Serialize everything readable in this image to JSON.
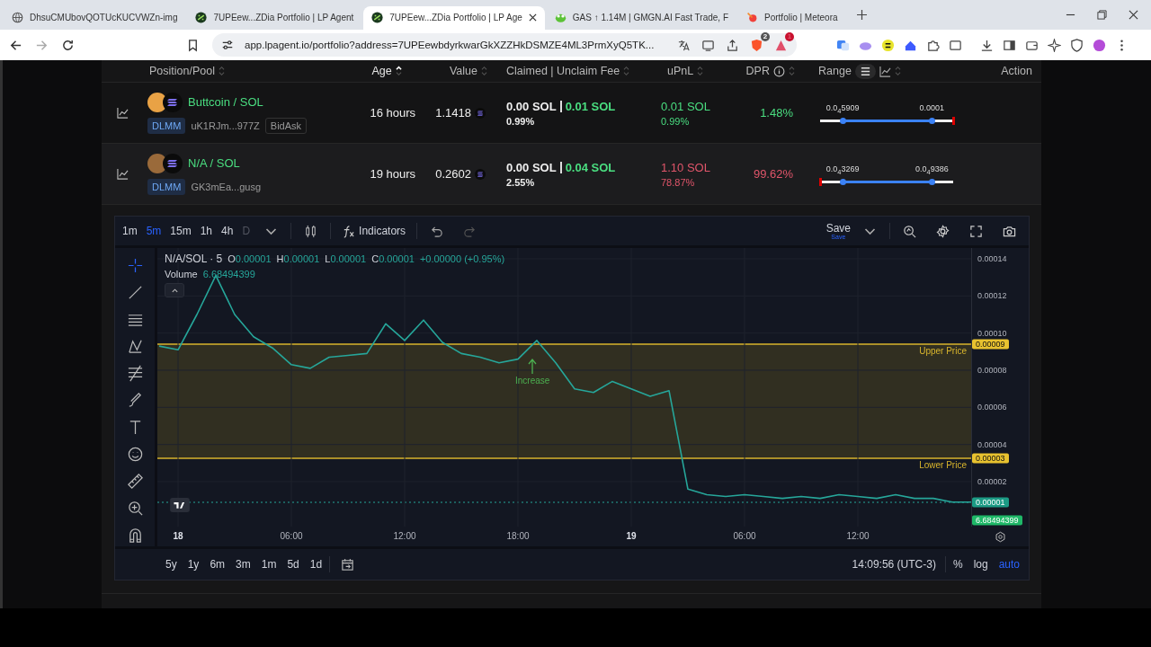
{
  "browser": {
    "tabs": [
      {
        "title": "DhsuCMUbovQOTUcKUCVWZn-img",
        "kind": "globe",
        "selected": false
      },
      {
        "title": "7UPEew...ZDia Portfolio | LP Agent",
        "kind": "lpagent",
        "selected": false
      },
      {
        "title": "7UPEew...ZDia Portfolio | LP Age",
        "kind": "lpagent",
        "selected": true
      },
      {
        "title": "GAS ↑ 1.14M | GMGN.AI Fast Trade, F",
        "kind": "gmgn",
        "selected": false
      },
      {
        "title": "Portfolio | Meteora",
        "kind": "meteora",
        "selected": false
      }
    ],
    "address": "app.lpagent.io/portfolio?address=7UPEewbdyrkwarGkXZZHkDSMZE4ML3PrmXyQ5TK...",
    "badges": [
      "2",
      "1"
    ]
  },
  "table": {
    "columns": [
      {
        "label": "Position/Pool",
        "kind": "plain",
        "sortable": true,
        "sorted": false
      },
      {
        "label": "Age",
        "kind": "plain",
        "sortable": true,
        "sorted": true
      },
      {
        "label": "Value",
        "kind": "plain",
        "sortable": true,
        "sorted": false
      },
      {
        "label": "Claimed | Unclaim Fee",
        "kind": "plain",
        "sortable": true,
        "sorted": false
      },
      {
        "label": "uPnL",
        "kind": "plain",
        "sortable": true,
        "sorted": false
      },
      {
        "label": "DPR",
        "kind": "info",
        "sortable": true,
        "sorted": false
      },
      {
        "label": "Range",
        "kind": "range",
        "sortable": true,
        "sorted": false
      },
      {
        "label": "Action",
        "kind": "plain",
        "sortable": false,
        "sorted": false
      }
    ],
    "rows": [
      {
        "pair": "Buttcoin / SOL",
        "protocol": "DLMM",
        "address": "uK1RJm...977Z",
        "strategy": "BidAsk",
        "age": "16 hours",
        "value": "1.1418",
        "claimed": "0.00 SOL",
        "unclaimed": "0.01 SOL",
        "fee_pct": "0.99%",
        "upnl": "0.01 SOL",
        "upnl_pct": "0.99%",
        "positive": true,
        "dpr": "1.48%",
        "range": {
          "low": {
            "label": "0.0$_{4}$5909",
            "level": 0.17
          },
          "high": {
            "label": "0.0001",
            "level": 0.84
          },
          "price": {
            "level": 1.0
          }
        }
      },
      {
        "pair": "N/A / SOL",
        "protocol": "DLMM",
        "address": "GK3mEa...gusg",
        "age": "19 hours",
        "value": "0.2602",
        "claimed": "0.00 SOL",
        "unclaimed": "0.04 SOL",
        "fee_pct": "2.55%",
        "upnl": "1.10 SOL",
        "upnl_pct": "78.87%",
        "positive": false,
        "dpr": "99.62%",
        "range": {
          "low": {
            "label": "0.0$_{4}$3269",
            "level": 0.17
          },
          "high": {
            "label": "0.0$_{4}$9386",
            "level": 0.84
          },
          "price": {
            "level": 0.0
          }
        }
      }
    ]
  },
  "chart": {
    "intervals": [
      {
        "label": "1m",
        "selected": false,
        "disabled": false
      },
      {
        "label": "5m",
        "selected": true,
        "disabled": false
      },
      {
        "label": "15m",
        "selected": false,
        "disabled": false
      },
      {
        "label": "1h",
        "selected": false,
        "disabled": false
      },
      {
        "label": "4h",
        "selected": false,
        "disabled": false
      },
      {
        "label": "D",
        "selected": false,
        "disabled": true
      }
    ],
    "indicators_label": "Indicators",
    "save": {
      "label": "Save",
      "sublabel": "Save"
    },
    "legend": {
      "symbol": "N/A/SOL · 5",
      "ohlc": [
        {
          "key": "O",
          "value": "0.00001"
        },
        {
          "key": "H",
          "value": "0.00001"
        },
        {
          "key": "L",
          "value": "0.00001"
        },
        {
          "key": "C",
          "value": "0.00001"
        }
      ],
      "change": "+0.00000 (+0.95%)",
      "volume_label": "Volume",
      "volume_value": "6.68494399"
    },
    "time_labels": [
      {
        "label": "18",
        "major": true
      },
      {
        "label": "06:00",
        "major": false
      },
      {
        "label": "12:00",
        "major": false
      },
      {
        "label": "18:00",
        "major": false
      },
      {
        "label": "19",
        "major": true
      },
      {
        "label": "06:00",
        "major": false
      },
      {
        "label": "12:00",
        "major": false
      }
    ],
    "levels": [
      {
        "label": "Upper Price",
        "tag": "0.00009"
      },
      {
        "label": "Lower Price",
        "tag": "0.00003"
      }
    ],
    "last_price": "0.00001",
    "chart_data": {
      "type": "line",
      "grid": true,
      "ylim": [
        -4.2e-06,
        0.0001458
      ],
      "yticks": [
        {
          "value": 0.00014,
          "label": "0.00014"
        },
        {
          "value": 0.00012,
          "label": "0.00012"
        },
        {
          "value": 0.0001,
          "label": "0.00010"
        },
        {
          "value": 8e-05,
          "label": "0.00008"
        },
        {
          "value": 6e-05,
          "label": "0.00006"
        },
        {
          "value": 4e-05,
          "label": "0.00004"
        },
        {
          "value": 2e-05,
          "label": "0.00002"
        }
      ],
      "series": [
        {
          "color": "#26a69a",
          "values": [
            9.3e-05,
            9.1e-05,
            0.00011,
            0.000131,
            0.00011,
            9.8e-05,
            9.2e-05,
            8.3e-05,
            8.1e-05,
            8.7e-05,
            8.8e-05,
            8.9e-05,
            0.000105,
            9.6e-05,
            0.000107,
            9.5e-05,
            8.9e-05,
            8.7e-05,
            8.4e-05,
            8.6e-05,
            9.6e-05,
            8.4e-05,
            7e-05,
            6.8e-05,
            7.4e-05,
            7e-05,
            6.6e-05,
            6.9e-05,
            1.6e-05,
            1.3e-05,
            1.2e-05,
            1.3e-05,
            1.2e-05,
            1.1e-05,
            1.2e-05,
            1.1e-05,
            1.3e-05,
            1.2e-05,
            1.1e-05,
            1.3e-05,
            1.1e-05,
            1.1e-05,
            9e-06,
            9e-06
          ]
        }
      ]
    },
    "volume_tag": "6.68494399",
    "marker": "Increase",
    "ranges": [
      "5y",
      "1y",
      "6m",
      "3m",
      "1m",
      "5d",
      "1d"
    ],
    "clock": "14:09:56 (UTC-3)",
    "scale_options": [
      {
        "label": "%",
        "selected": false
      },
      {
        "label": "log",
        "selected": false
      },
      {
        "label": "auto",
        "selected": true
      }
    ]
  }
}
